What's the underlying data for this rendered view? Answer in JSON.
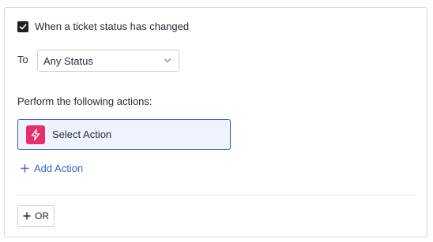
{
  "trigger": {
    "checked": true,
    "label": "When a ticket status has changed"
  },
  "condition": {
    "to_label": "To",
    "status_value": "Any Status"
  },
  "actions": {
    "heading": "Perform the following actions:",
    "select_action_label": "Select Action",
    "add_action_label": "Add Action"
  },
  "or_button": {
    "label": "OR"
  },
  "icons": {
    "checkbox": "checkmark-icon",
    "dropdown": "chevron-down-icon",
    "action": "lightning-bolt-icon",
    "add": "plus-icon"
  },
  "colors": {
    "accent_blue": "#3767c5",
    "select_border": "#2f5fb3",
    "select_bg": "#eef3fd",
    "bolt_bg": "#ea2e6b",
    "checkbox_bg": "#1f1f1f"
  }
}
